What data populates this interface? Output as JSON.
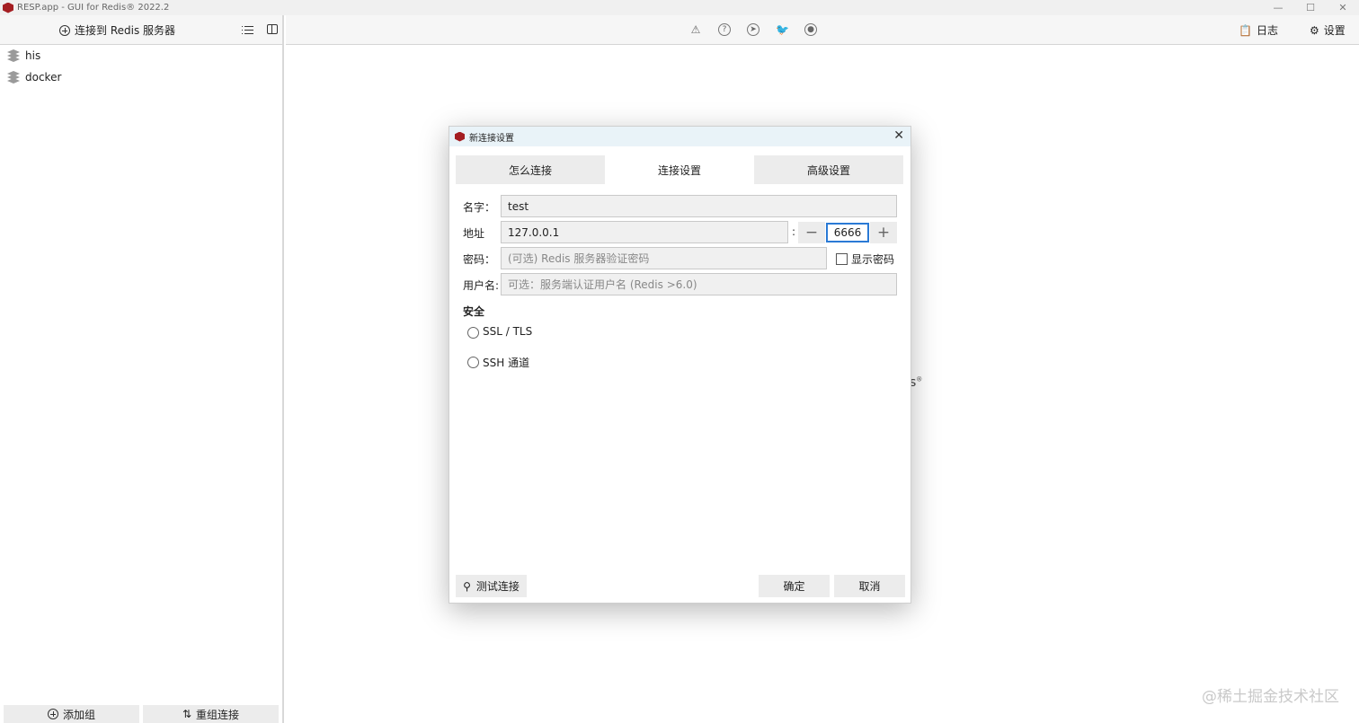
{
  "window": {
    "title": "RESP.app - GUI for Redis® 2022.2",
    "minimize": "—",
    "maximize": "☐",
    "close": "✕"
  },
  "left": {
    "connect_label": "连接到 Redis 服务器",
    "connections": [
      {
        "name": "his"
      },
      {
        "name": "docker"
      }
    ],
    "add_group_label": "添加组",
    "regroup_label": "重组连接"
  },
  "toolbar": {
    "icons": [
      "warning-icon",
      "help-icon",
      "telegram-icon",
      "twitter-icon",
      "github-icon"
    ],
    "log_label": "日志",
    "settings_label": "设置"
  },
  "dialog": {
    "title": "新连接设置",
    "tabs": [
      {
        "label": "怎么连接",
        "active": false
      },
      {
        "label": "连接设置",
        "active": true
      },
      {
        "label": "高级设置",
        "active": false
      }
    ],
    "fields": {
      "name_label": "名字：",
      "name_value": "test",
      "address_label": "地址",
      "host_value": "127.0.0.1",
      "port_value": "6666",
      "password_label": "密码：",
      "password_placeholder": "(可选) Redis 服务器验证密码",
      "show_password_label": "显示密码",
      "username_label": "用户名:",
      "username_placeholder": "可选：服务端认证用户名 (Redis >6.0)"
    },
    "security": {
      "title": "安全",
      "options": [
        {
          "label": "SSL / TLS",
          "selected": false
        },
        {
          "label": "SSH 通道",
          "selected": false
        }
      ]
    },
    "buttons": {
      "test_label": "测试连接",
      "ok_label": "确定",
      "cancel_label": "取消"
    }
  },
  "watermark": "@稀土掘金技术社区",
  "colors": {
    "accent": "#2a7ad5",
    "brand": "#a41e22"
  }
}
